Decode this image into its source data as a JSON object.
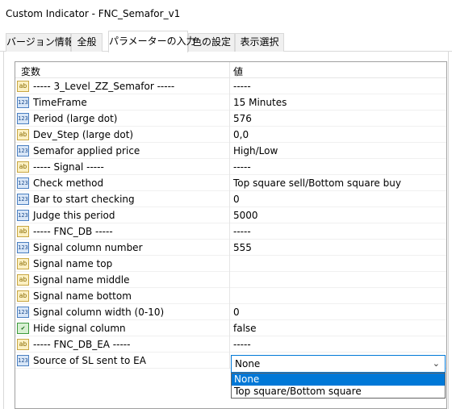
{
  "window": {
    "title": "Custom Indicator - FNC_Semafor_v1"
  },
  "tabs": [
    {
      "label": "バージョン情報",
      "active": false
    },
    {
      "label": "全般",
      "active": false
    },
    {
      "label": "パラメーターの入力",
      "active": true
    },
    {
      "label": "色の設定",
      "active": false
    },
    {
      "label": "表示選択",
      "active": false
    }
  ],
  "table": {
    "headers": {
      "name": "変数",
      "value": "値"
    },
    "rows": [
      {
        "icon": "ab",
        "name": "----- 3_Level_ZZ_Semafor -----",
        "value": "-----"
      },
      {
        "icon": "123",
        "name": "TimeFrame",
        "value": "15 Minutes"
      },
      {
        "icon": "123",
        "name": "Period (large dot)",
        "value": "576"
      },
      {
        "icon": "ab",
        "name": "Dev_Step (large dot)",
        "value": "0,0"
      },
      {
        "icon": "123",
        "name": "Semafor applied price",
        "value": "High/Low"
      },
      {
        "icon": "ab",
        "name": "----- Signal -----",
        "value": "-----"
      },
      {
        "icon": "123",
        "name": "Check method",
        "value": "Top square sell/Bottom square buy"
      },
      {
        "icon": "123",
        "name": "Bar to start checking",
        "value": "0"
      },
      {
        "icon": "123",
        "name": "Judge this period",
        "value": "5000"
      },
      {
        "icon": "ab",
        "name": "----- FNC_DB -----",
        "value": "-----"
      },
      {
        "icon": "123",
        "name": "Signal column number",
        "value": "555"
      },
      {
        "icon": "ab",
        "name": "Signal name top",
        "value": ""
      },
      {
        "icon": "ab",
        "name": "Signal name middle",
        "value": ""
      },
      {
        "icon": "ab",
        "name": "Signal name bottom",
        "value": ""
      },
      {
        "icon": "123",
        "name": "Signal column width (0-10)",
        "value": "0"
      },
      {
        "icon": "bool",
        "name": "Hide signal column",
        "value": "false"
      },
      {
        "icon": "ab",
        "name": "----- FNC_DB_EA -----",
        "value": "-----"
      },
      {
        "icon": "123",
        "name": "Source of SL sent to EA",
        "value": ""
      }
    ]
  },
  "dropdown": {
    "selected": "None",
    "options": [
      "None",
      "Top square/Bottom square"
    ]
  }
}
